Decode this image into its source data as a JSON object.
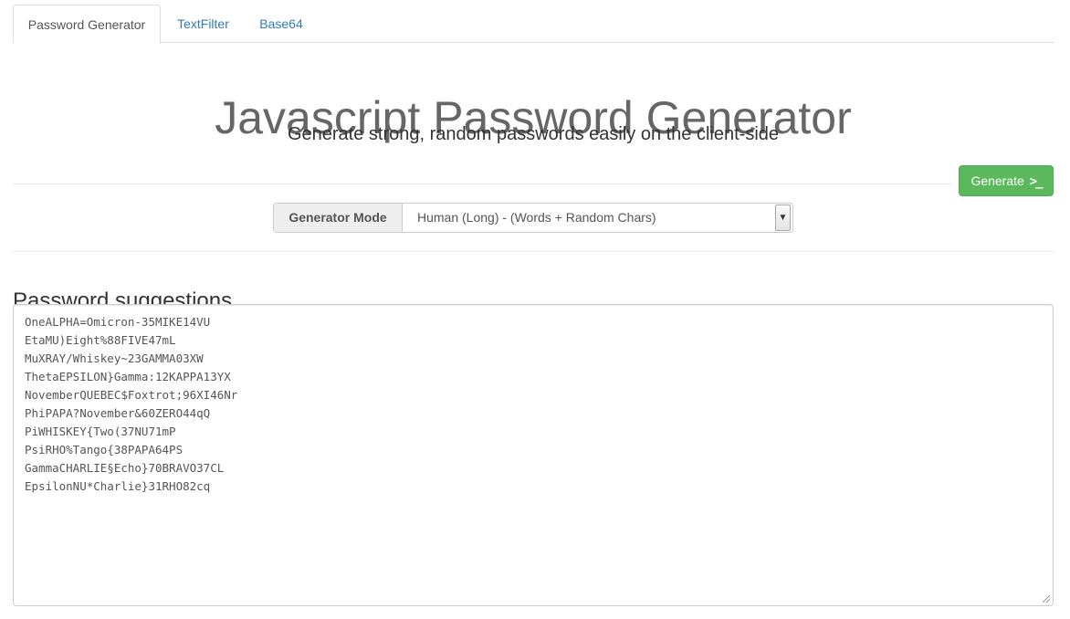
{
  "tabs": [
    {
      "label": "Password Generator",
      "active": true
    },
    {
      "label": "TextFilter",
      "active": false
    },
    {
      "label": "Base64",
      "active": false
    }
  ],
  "header": {
    "title": "Javascript Password Generator",
    "subtitle": "Generate strong, random passwords easily on the client-side"
  },
  "toolbar": {
    "generate_label": "Generate",
    "generate_icon": ">_"
  },
  "mode": {
    "label": "Generator Mode",
    "selected": "Human (Long) - (Words + Random Chars)"
  },
  "suggestions": {
    "heading": "Password suggestions",
    "passwords": [
      "OneALPHA=Omicron-35MIKE14VU",
      "EtaMU)Eight%88FIVE47mL",
      "MuXRAY/Whiskey~23GAMMA03XW",
      "ThetaEPSILON}Gamma:12KAPPA13YX",
      "NovemberQUEBEC$Foxtrot;96XI46Nr",
      "PhiPAPA?November&60ZERO44qQ",
      "PiWHISKEY{Two(37NU71mP",
      "PsiRHO%Tango{38PAPA64PS",
      "GammaCHARLIE§Echo}70BRAVO37CL",
      "EpsilonNU*Charlie}31RHO82cq"
    ]
  },
  "colors": {
    "link": "#337ab7",
    "success": "#5cb85c",
    "title": "#666666"
  }
}
